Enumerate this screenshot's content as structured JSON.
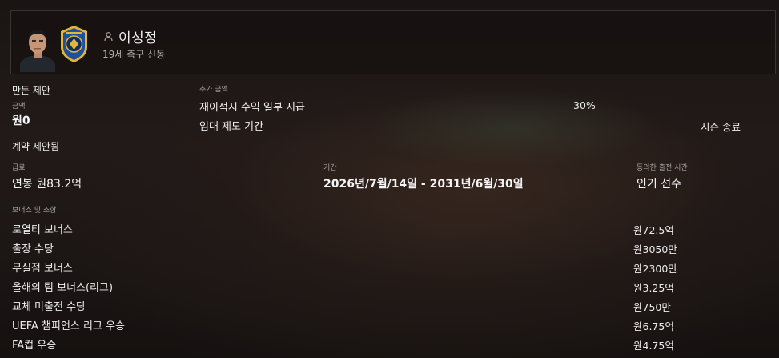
{
  "player": {
    "name": "이성정",
    "subtitle": "19세 축구 신동"
  },
  "offer": {
    "heading": "만든 제안",
    "amount_label": "금액",
    "amount_value": "원0"
  },
  "extra": {
    "heading": "추가 금액",
    "rows": [
      {
        "label": "재이적시 수익 일부 지급",
        "value": "30%"
      },
      {
        "label": "임대 제도 기간",
        "value": "시즌 종료"
      }
    ]
  },
  "contract": {
    "heading": "계약 제안됨",
    "salary_label": "급료",
    "salary_value": "연봉 원83.2억",
    "period_label": "기간",
    "period_value": "2026년/7월/14일 - 2031년/6월/30일",
    "playtime_label": "동의한 출전 시간",
    "playtime_value": "인기 선수"
  },
  "bonuses": {
    "heading": "보너스 및 조항",
    "rows": [
      {
        "label": "로열티 보너스",
        "value": "원72.5억"
      },
      {
        "label": "출장 수당",
        "value": "원3050만"
      },
      {
        "label": "무실점 보너스",
        "value": "원2300만"
      },
      {
        "label": "올해의 팀 보너스(리그)",
        "value": "원3.25억"
      },
      {
        "label": "교체 미출전 수당",
        "value": "원750만"
      },
      {
        "label": "UEFA 챔피언스 리그 우승",
        "value": "원6.75억"
      },
      {
        "label": "FA컵 우승",
        "value": "원4.75억"
      }
    ]
  },
  "icons": {
    "avatar": "player-portrait",
    "club": "club-crest-icon",
    "person": "person-icon"
  },
  "colors": {
    "crest_blue": "#1e4fa3",
    "crest_gold": "#e2b634"
  }
}
